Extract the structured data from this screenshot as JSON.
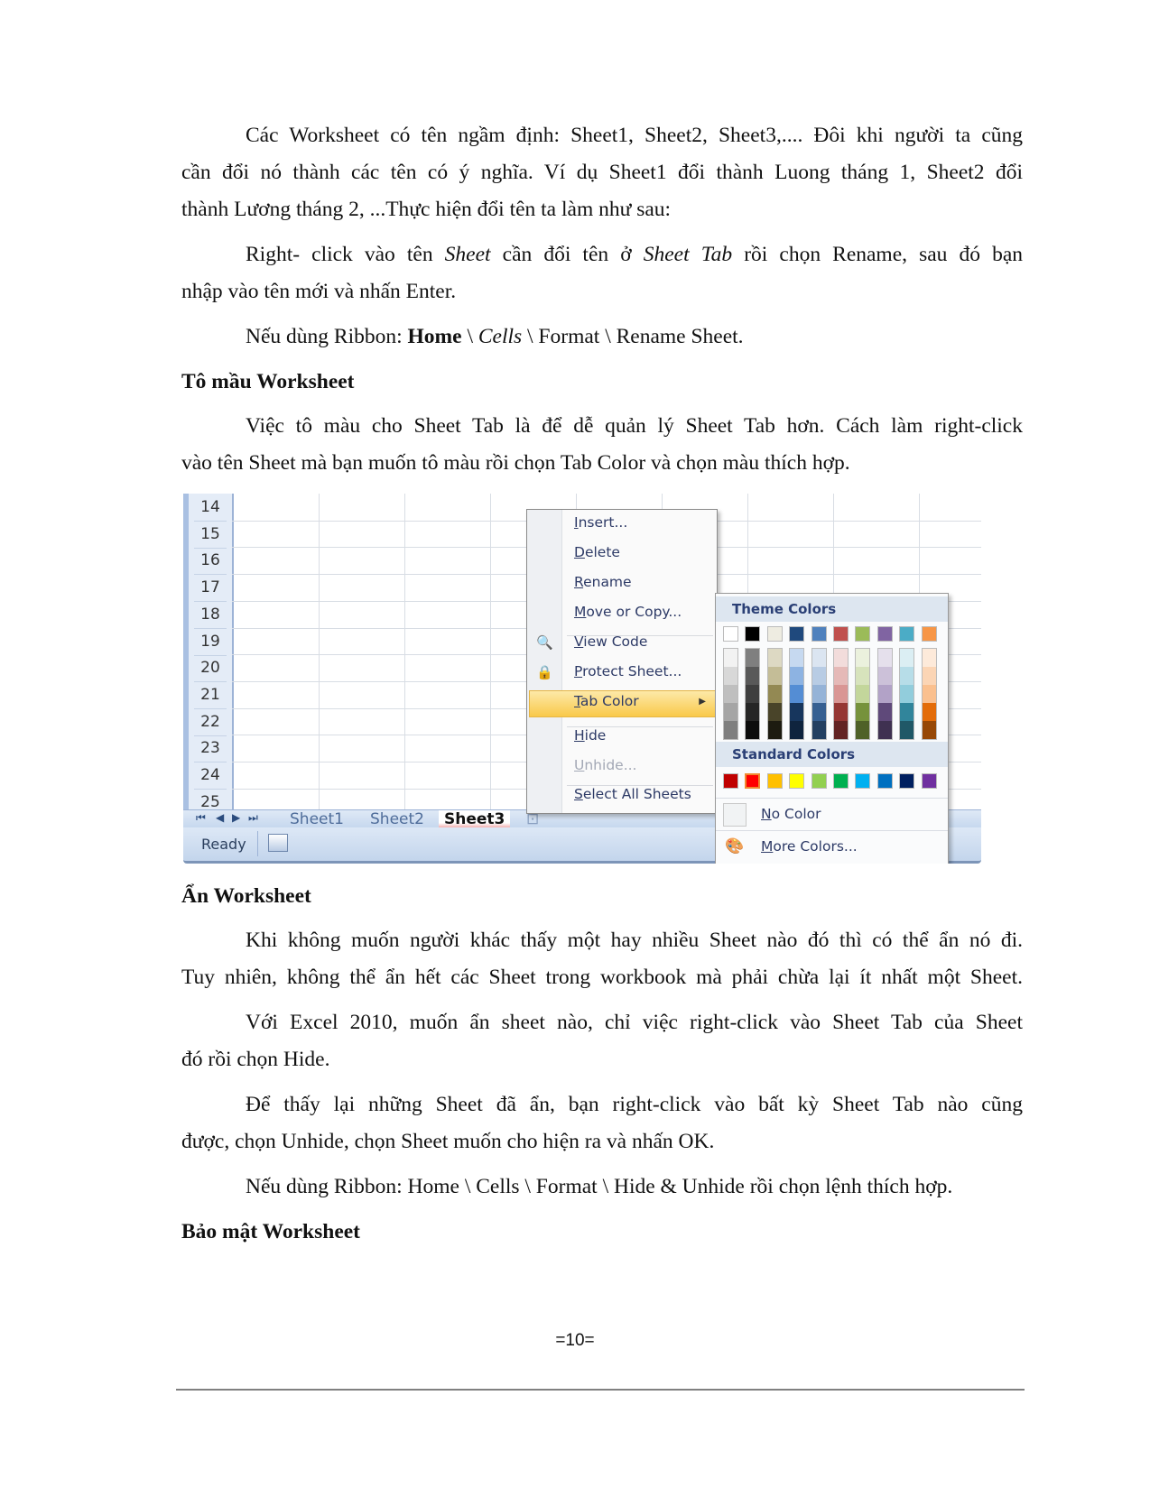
{
  "paragraphs": {
    "p1_line1": "Các Worksheet có tên ngầm định: Sheet1, Sheet2, Sheet3,.... Đôi khi người ta cũng",
    "p1_line2": "cần đổi nó thành các tên có ý nghĩa. Ví dụ Sheet1 đổi thành Luong tháng 1, Sheet2 đổi",
    "p1_line3": "thành Lương tháng 2, ...Thực hiện đổi tên ta làm như sau:",
    "p2_a": "Right- click vào tên ",
    "p2_b": "Sheet",
    "p2_c": " cần đổi tên ở ",
    "p2_d": "Sheet Tab",
    "p2_e": " rồi chọn Rename, sau đó bạn",
    "p2_line2": "nhập vào tên mới và nhấn Enter.",
    "p3_a": "Nếu dùng Ribbon: ",
    "p3_b": "Home",
    "p3_c": " \\ ",
    "p3_d": "Cells",
    "p3_e": " \\ Format \\ Rename Sheet.",
    "p4_line1": "Việc tô màu cho Sheet Tab là để dễ quản lý Sheet Tab hơn. Cách làm right-click",
    "p4_line2": "vào tên Sheet mà bạn muốn tô màu rồi chọn Tab Color và chọn màu thích hợp.",
    "p5_line1": "Khi không muốn người khác thấy một hay nhiều Sheet nào đó thì có thể ẩn nó đi.",
    "p5_line2": "Tuy nhiên, không thể ẩn hết các Sheet trong workbook mà phải chừa lại ít nhất một Sheet.",
    "p6_line1": "Với Excel 2010, muốn ẩn sheet nào, chỉ việc right-click vào Sheet Tab của Sheet",
    "p6_line2": "đó rồi chọn Hide.",
    "p7_line1": "Để thấy lại những Sheet đã ẩn, bạn right-click vào bất kỳ Sheet Tab nào cũng",
    "p7_line2": "được, chọn Unhide, chọn Sheet muốn cho hiện ra và nhấn OK.",
    "p8": "Nếu dùng Ribbon: Home \\ Cells \\ Format \\ Hide & Unhide rồi chọn lệnh thích hợp."
  },
  "headings": {
    "h1": "Tô mầu Worksheet",
    "h2": "Ẩn Worksheet",
    "h3": "Bảo mật Worksheet"
  },
  "excel": {
    "row_numbers": [
      "14",
      "15",
      "16",
      "17",
      "18",
      "19",
      "20",
      "21",
      "22",
      "23",
      "24",
      "25"
    ],
    "sheet_tabs": [
      "Sheet1",
      "Sheet2",
      "Sheet3"
    ],
    "active_tab": "Sheet3",
    "nav_icons": [
      "first-sheet-icon",
      "prev-sheet-icon",
      "next-sheet-icon",
      "last-sheet-icon"
    ],
    "status": "Ready",
    "context_menu": [
      {
        "key": "I",
        "rest": "nsert...",
        "enabled": true
      },
      {
        "key": "D",
        "rest": "elete",
        "enabled": true
      },
      {
        "key": "R",
        "rest": "ename",
        "enabled": true
      },
      {
        "key": "M",
        "rest": "ove or Copy...",
        "enabled": true
      },
      {
        "key": "V",
        "rest": "iew Code",
        "enabled": true,
        "icon": "view-code-icon"
      },
      {
        "key": "P",
        "rest": "rotect Sheet...",
        "enabled": true,
        "icon": "protect-sheet-icon"
      },
      {
        "key": "T",
        "rest": "ab Color",
        "enabled": true,
        "highlighted": true,
        "submenu": true
      },
      {
        "key": "H",
        "rest": "ide",
        "enabled": true
      },
      {
        "key": "U",
        "rest": "nhide...",
        "enabled": false
      },
      {
        "key": "S",
        "rest": "elect All Sheets",
        "enabled": true
      }
    ],
    "palette": {
      "theme_label": "Theme Colors",
      "standard_label": "Standard Colors",
      "theme_top": [
        "#ffffff",
        "#000000",
        "#eeece1",
        "#1f497d",
        "#4f81bd",
        "#c0504d",
        "#9bbb59",
        "#8064a2",
        "#4bacc6",
        "#f79646"
      ],
      "theme_shades": [
        [
          "#f2f2f2",
          "#d8d8d8",
          "#bfbfbf",
          "#a5a5a5",
          "#7f7f7f"
        ],
        [
          "#7f7f7f",
          "#595959",
          "#3f3f3f",
          "#262626",
          "#0c0c0c"
        ],
        [
          "#ddd9c3",
          "#c4bd97",
          "#938953",
          "#494429",
          "#1d1b10"
        ],
        [
          "#c6d9f0",
          "#8db3e2",
          "#548dd4",
          "#17365d",
          "#0f243e"
        ],
        [
          "#dbe5f1",
          "#b8cce4",
          "#95b3d7",
          "#366092",
          "#244061"
        ],
        [
          "#f2dcdb",
          "#e5b9b7",
          "#d99694",
          "#953734",
          "#632423"
        ],
        [
          "#ebf1dd",
          "#d7e3bc",
          "#c3d69b",
          "#76923c",
          "#4f6128"
        ],
        [
          "#e5e0ec",
          "#ccc1d9",
          "#b2a2c7",
          "#5f497a",
          "#3f3151"
        ],
        [
          "#dbeef3",
          "#b7dde8",
          "#92cddc",
          "#31859b",
          "#205867"
        ],
        [
          "#fdeada",
          "#fbd5b5",
          "#fac08f",
          "#e36c09",
          "#974806"
        ]
      ],
      "standard": [
        "#c00000",
        "#ff0000",
        "#ffc000",
        "#ffff00",
        "#92d050",
        "#00b050",
        "#00b0f0",
        "#0070c0",
        "#002060",
        "#7030a0"
      ],
      "selected_standard_index": 1,
      "no_color": {
        "key": "N",
        "rest": "o Color"
      },
      "more_colors": {
        "key": "M",
        "rest": "ore Colors..."
      }
    }
  },
  "footer": {
    "page_number": "=10="
  }
}
